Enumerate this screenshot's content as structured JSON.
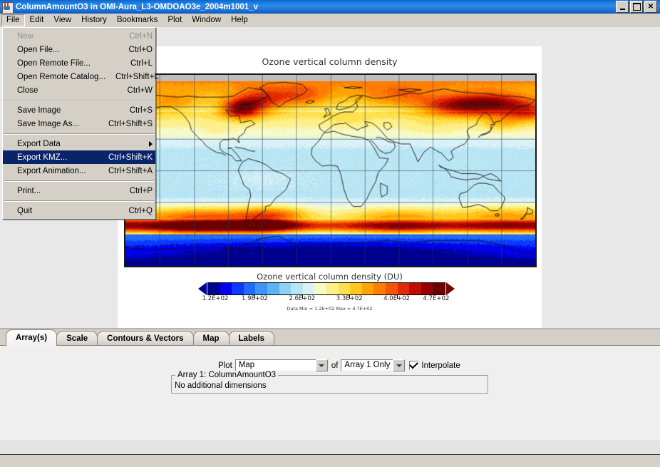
{
  "window": {
    "title": "ColumnAmountO3 in OMI-Aura_L3-OMDOAO3e_2004m1001_v",
    "icon": "java-coffee-cup-icon",
    "minimize_label": "",
    "maximize_label": "",
    "close_label": "✕"
  },
  "menubar": {
    "items": [
      {
        "label": "File"
      },
      {
        "label": "Edit"
      },
      {
        "label": "View"
      },
      {
        "label": "History"
      },
      {
        "label": "Bookmarks"
      },
      {
        "label": "Plot"
      },
      {
        "label": "Window"
      },
      {
        "label": "Help"
      }
    ]
  },
  "file_menu": {
    "open": true,
    "items": [
      {
        "label": "New",
        "accel": "Ctrl+N",
        "state": "disabled",
        "type": "item"
      },
      {
        "label": "Open File...",
        "accel": "Ctrl+O",
        "state": "normal",
        "type": "item"
      },
      {
        "label": "Open Remote File...",
        "accel": "Ctrl+L",
        "state": "normal",
        "type": "item"
      },
      {
        "label": "Open Remote Catalog...",
        "accel": "Ctrl+Shift+L",
        "state": "normal",
        "type": "item"
      },
      {
        "label": "Close",
        "accel": "Ctrl+W",
        "state": "normal",
        "type": "item"
      },
      {
        "label": "",
        "accel": "",
        "state": "normal",
        "type": "separator"
      },
      {
        "label": "Save Image",
        "accel": "Ctrl+S",
        "state": "normal",
        "type": "item"
      },
      {
        "label": "Save Image As...",
        "accel": "Ctrl+Shift+S",
        "state": "normal",
        "type": "item"
      },
      {
        "label": "",
        "accel": "",
        "state": "normal",
        "type": "separator"
      },
      {
        "label": "Export Data",
        "accel": "",
        "state": "normal",
        "type": "submenu"
      },
      {
        "label": "Export KMZ...",
        "accel": "Ctrl+Shift+K",
        "state": "highlight",
        "type": "item"
      },
      {
        "label": "Export Animation...",
        "accel": "Ctrl+Shift+A",
        "state": "normal",
        "type": "item"
      },
      {
        "label": "",
        "accel": "",
        "state": "normal",
        "type": "separator"
      },
      {
        "label": "Print...",
        "accel": "Ctrl+P",
        "state": "normal",
        "type": "item"
      },
      {
        "label": "",
        "accel": "",
        "state": "normal",
        "type": "separator"
      },
      {
        "label": "Quit",
        "accel": "Ctrl+Q",
        "state": "normal",
        "type": "item"
      }
    ]
  },
  "plot": {
    "title": "Ozone vertical column density",
    "colorbar_title": "Ozone vertical column density (DU)",
    "minmax_text": "Data Min = 1.2E+02  Max = 4.7E+02",
    "tick_labels": [
      "1.2E+02",
      "1.9E+02",
      "2.6E+02",
      "3.3E+02",
      "4.0E+02",
      "4.7E+02"
    ]
  },
  "chart_data": {
    "type": "heatmap",
    "title": "Ozone vertical column density",
    "variable": "ColumnAmountO3",
    "units": "DU",
    "colorbar_label": "Ozone vertical column density (DU)",
    "data_min": 120,
    "data_max": 470,
    "scale_ticks": [
      120,
      190,
      260,
      330,
      400,
      470
    ],
    "scale_tick_labels": [
      "1.2E+02",
      "1.9E+02",
      "2.6E+02",
      "3.3E+02",
      "4.0E+02",
      "4.7E+02"
    ],
    "projection": "cylindrical-equidistant",
    "xlim": [
      -180,
      180
    ],
    "ylim": [
      -90,
      90
    ],
    "grid": true,
    "grid_spacing_deg": 30,
    "colormap": "rainbow-blue-to-red",
    "colormap_stops": [
      "#00008f",
      "#0000ea",
      "#0b39ff",
      "#1f6bff",
      "#3d93f7",
      "#5fb2f0",
      "#8fd0f0",
      "#b8e5f4",
      "#d9f2f7",
      "#f6f9c8",
      "#fdf08a",
      "#ffe04d",
      "#ffc61f",
      "#ffa400",
      "#ff7d00",
      "#f65400",
      "#e02b00",
      "#bc0d00",
      "#950000",
      "#6b0000"
    ],
    "legend_position": "bottom",
    "annotations": [
      "Ozone low (blue, ~120-180 DU) over Antarctic polar region - ozone hole",
      "Ozone high (red/orange, ~380-470 DU) in southern mid-latitude band ~45-60S",
      "Ozone high (orange, ~350-420 DU) over northeastern Canada / Hudson Bay",
      "Ozone elevated (yellow-orange) over Siberia and Sea of Okhotsk",
      "Tropics low-moderate (light blue, ~230-270 DU)"
    ]
  },
  "tabs": {
    "items": [
      {
        "label": "Array(s)",
        "active": true
      },
      {
        "label": "Scale",
        "active": false
      },
      {
        "label": "Contours & Vectors",
        "active": false
      },
      {
        "label": "Map",
        "active": false
      },
      {
        "label": "Labels",
        "active": false
      }
    ]
  },
  "controls": {
    "plot_label": "Plot",
    "plot_value": "Map",
    "of_label": "of",
    "array_value": "Array 1 Only",
    "interpolate_label": "Interpolate",
    "interpolate_checked": true,
    "group_title": "Array 1: ColumnAmountO3",
    "group_body": "No additional dimensions"
  }
}
